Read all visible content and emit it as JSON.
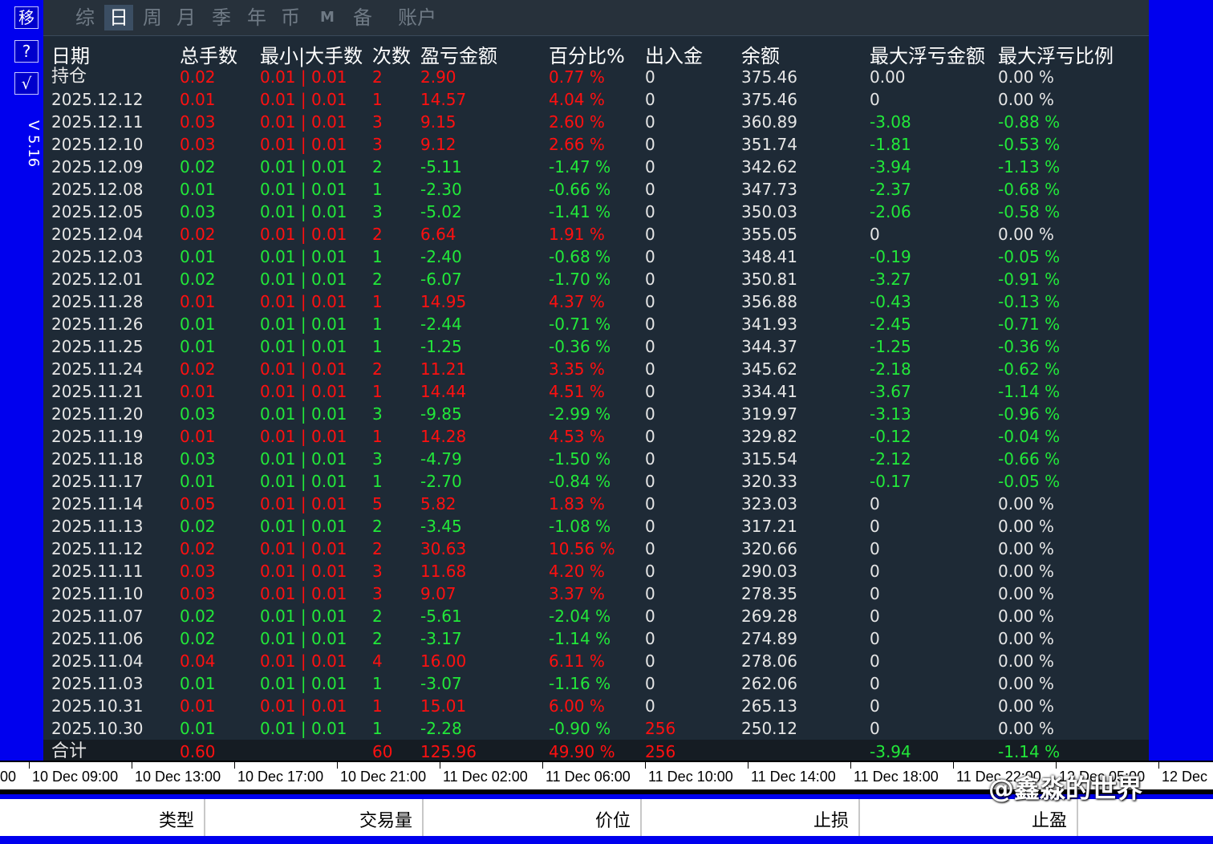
{
  "sidebar": {
    "buttons": [
      "移",
      "?",
      "√"
    ],
    "version": "V 5.16"
  },
  "tabs": [
    "综",
    "日",
    "周",
    "月",
    "季",
    "年",
    "币",
    "M",
    "备",
    "账户"
  ],
  "active_tab": "日",
  "headers": [
    "日期",
    "总手数",
    "最小|大手数",
    "次数",
    "盈亏金额",
    "百分比%",
    "出入金",
    "余额",
    "最大浮亏金额",
    "最大浮亏比例"
  ],
  "rows": [
    {
      "date": "持仓",
      "lots": "0.02",
      "minmax": "0.01 | 0.01",
      "count": "2",
      "pnl": "2.90",
      "pct": "0.77 %",
      "flow": "0",
      "balance": "375.46",
      "maxdd": "0.00",
      "maxddpct": "0.00 %",
      "color": "r",
      "ddcolor": "w"
    },
    {
      "date": "2025.12.12",
      "lots": "0.01",
      "minmax": "0.01 | 0.01",
      "count": "1",
      "pnl": "14.57",
      "pct": "4.04 %",
      "flow": "0",
      "balance": "375.46",
      "maxdd": "0",
      "maxddpct": "0.00 %",
      "color": "r",
      "ddcolor": "w"
    },
    {
      "date": "2025.12.11",
      "lots": "0.03",
      "minmax": "0.01 | 0.01",
      "count": "3",
      "pnl": "9.15",
      "pct": "2.60 %",
      "flow": "0",
      "balance": "360.89",
      "maxdd": "-3.08",
      "maxddpct": "-0.88 %",
      "color": "r",
      "ddcolor": "g"
    },
    {
      "date": "2025.12.10",
      "lots": "0.03",
      "minmax": "0.01 | 0.01",
      "count": "3",
      "pnl": "9.12",
      "pct": "2.66 %",
      "flow": "0",
      "balance": "351.74",
      "maxdd": "-1.81",
      "maxddpct": "-0.53 %",
      "color": "r",
      "ddcolor": "g"
    },
    {
      "date": "2025.12.09",
      "lots": "0.02",
      "minmax": "0.01 | 0.01",
      "count": "2",
      "pnl": "-5.11",
      "pct": "-1.47 %",
      "flow": "0",
      "balance": "342.62",
      "maxdd": "-3.94",
      "maxddpct": "-1.13 %",
      "color": "g",
      "ddcolor": "g"
    },
    {
      "date": "2025.12.08",
      "lots": "0.01",
      "minmax": "0.01 | 0.01",
      "count": "1",
      "pnl": "-2.30",
      "pct": "-0.66 %",
      "flow": "0",
      "balance": "347.73",
      "maxdd": "-2.37",
      "maxddpct": "-0.68 %",
      "color": "g",
      "ddcolor": "g"
    },
    {
      "date": "2025.12.05",
      "lots": "0.03",
      "minmax": "0.01 | 0.01",
      "count": "3",
      "pnl": "-5.02",
      "pct": "-1.41 %",
      "flow": "0",
      "balance": "350.03",
      "maxdd": "-2.06",
      "maxddpct": "-0.58 %",
      "color": "g",
      "ddcolor": "g"
    },
    {
      "date": "2025.12.04",
      "lots": "0.02",
      "minmax": "0.01 | 0.01",
      "count": "2",
      "pnl": "6.64",
      "pct": "1.91 %",
      "flow": "0",
      "balance": "355.05",
      "maxdd": "0",
      "maxddpct": "0.00 %",
      "color": "r",
      "ddcolor": "w"
    },
    {
      "date": "2025.12.03",
      "lots": "0.01",
      "minmax": "0.01 | 0.01",
      "count": "1",
      "pnl": "-2.40",
      "pct": "-0.68 %",
      "flow": "0",
      "balance": "348.41",
      "maxdd": "-0.19",
      "maxddpct": "-0.05 %",
      "color": "g",
      "ddcolor": "g"
    },
    {
      "date": "2025.12.01",
      "lots": "0.02",
      "minmax": "0.01 | 0.01",
      "count": "2",
      "pnl": "-6.07",
      "pct": "-1.70 %",
      "flow": "0",
      "balance": "350.81",
      "maxdd": "-3.27",
      "maxddpct": "-0.91 %",
      "color": "g",
      "ddcolor": "g"
    },
    {
      "date": "2025.11.28",
      "lots": "0.01",
      "minmax": "0.01 | 0.01",
      "count": "1",
      "pnl": "14.95",
      "pct": "4.37 %",
      "flow": "0",
      "balance": "356.88",
      "maxdd": "-0.43",
      "maxddpct": "-0.13 %",
      "color": "r",
      "ddcolor": "g"
    },
    {
      "date": "2025.11.26",
      "lots": "0.01",
      "minmax": "0.01 | 0.01",
      "count": "1",
      "pnl": "-2.44",
      "pct": "-0.71 %",
      "flow": "0",
      "balance": "341.93",
      "maxdd": "-2.45",
      "maxddpct": "-0.71 %",
      "color": "g",
      "ddcolor": "g"
    },
    {
      "date": "2025.11.25",
      "lots": "0.01",
      "minmax": "0.01 | 0.01",
      "count": "1",
      "pnl": "-1.25",
      "pct": "-0.36 %",
      "flow": "0",
      "balance": "344.37",
      "maxdd": "-1.25",
      "maxddpct": "-0.36 %",
      "color": "g",
      "ddcolor": "g"
    },
    {
      "date": "2025.11.24",
      "lots": "0.02",
      "minmax": "0.01 | 0.01",
      "count": "2",
      "pnl": "11.21",
      "pct": "3.35 %",
      "flow": "0",
      "balance": "345.62",
      "maxdd": "-2.18",
      "maxddpct": "-0.62 %",
      "color": "r",
      "ddcolor": "g"
    },
    {
      "date": "2025.11.21",
      "lots": "0.01",
      "minmax": "0.01 | 0.01",
      "count": "1",
      "pnl": "14.44",
      "pct": "4.51 %",
      "flow": "0",
      "balance": "334.41",
      "maxdd": "-3.67",
      "maxddpct": "-1.14 %",
      "color": "r",
      "ddcolor": "g"
    },
    {
      "date": "2025.11.20",
      "lots": "0.03",
      "minmax": "0.01 | 0.01",
      "count": "3",
      "pnl": "-9.85",
      "pct": "-2.99 %",
      "flow": "0",
      "balance": "319.97",
      "maxdd": "-3.13",
      "maxddpct": "-0.96 %",
      "color": "g",
      "ddcolor": "g"
    },
    {
      "date": "2025.11.19",
      "lots": "0.01",
      "minmax": "0.01 | 0.01",
      "count": "1",
      "pnl": "14.28",
      "pct": "4.53 %",
      "flow": "0",
      "balance": "329.82",
      "maxdd": "-0.12",
      "maxddpct": "-0.04 %",
      "color": "r",
      "ddcolor": "g"
    },
    {
      "date": "2025.11.18",
      "lots": "0.03",
      "minmax": "0.01 | 0.01",
      "count": "3",
      "pnl": "-4.79",
      "pct": "-1.50 %",
      "flow": "0",
      "balance": "315.54",
      "maxdd": "-2.12",
      "maxddpct": "-0.66 %",
      "color": "g",
      "ddcolor": "g"
    },
    {
      "date": "2025.11.17",
      "lots": "0.01",
      "minmax": "0.01 | 0.01",
      "count": "1",
      "pnl": "-2.70",
      "pct": "-0.84 %",
      "flow": "0",
      "balance": "320.33",
      "maxdd": "-0.17",
      "maxddpct": "-0.05 %",
      "color": "g",
      "ddcolor": "g"
    },
    {
      "date": "2025.11.14",
      "lots": "0.05",
      "minmax": "0.01 | 0.01",
      "count": "5",
      "pnl": "5.82",
      "pct": "1.83 %",
      "flow": "0",
      "balance": "323.03",
      "maxdd": "0",
      "maxddpct": "0.00 %",
      "color": "r",
      "ddcolor": "w"
    },
    {
      "date": "2025.11.13",
      "lots": "0.02",
      "minmax": "0.01 | 0.01",
      "count": "2",
      "pnl": "-3.45",
      "pct": "-1.08 %",
      "flow": "0",
      "balance": "317.21",
      "maxdd": "0",
      "maxddpct": "0.00 %",
      "color": "g",
      "ddcolor": "w"
    },
    {
      "date": "2025.11.12",
      "lots": "0.02",
      "minmax": "0.01 | 0.01",
      "count": "2",
      "pnl": "30.63",
      "pct": "10.56 %",
      "flow": "0",
      "balance": "320.66",
      "maxdd": "0",
      "maxddpct": "0.00 %",
      "color": "r",
      "ddcolor": "w"
    },
    {
      "date": "2025.11.11",
      "lots": "0.03",
      "minmax": "0.01 | 0.01",
      "count": "3",
      "pnl": "11.68",
      "pct": "4.20 %",
      "flow": "0",
      "balance": "290.03",
      "maxdd": "0",
      "maxddpct": "0.00 %",
      "color": "r",
      "ddcolor": "w"
    },
    {
      "date": "2025.11.10",
      "lots": "0.03",
      "minmax": "0.01 | 0.01",
      "count": "3",
      "pnl": "9.07",
      "pct": "3.37 %",
      "flow": "0",
      "balance": "278.35",
      "maxdd": "0",
      "maxddpct": "0.00 %",
      "color": "r",
      "ddcolor": "w"
    },
    {
      "date": "2025.11.07",
      "lots": "0.02",
      "minmax": "0.01 | 0.01",
      "count": "2",
      "pnl": "-5.61",
      "pct": "-2.04 %",
      "flow": "0",
      "balance": "269.28",
      "maxdd": "0",
      "maxddpct": "0.00 %",
      "color": "g",
      "ddcolor": "w"
    },
    {
      "date": "2025.11.06",
      "lots": "0.02",
      "minmax": "0.01 | 0.01",
      "count": "2",
      "pnl": "-3.17",
      "pct": "-1.14 %",
      "flow": "0",
      "balance": "274.89",
      "maxdd": "0",
      "maxddpct": "0.00 %",
      "color": "g",
      "ddcolor": "w"
    },
    {
      "date": "2025.11.04",
      "lots": "0.04",
      "minmax": "0.01 | 0.01",
      "count": "4",
      "pnl": "16.00",
      "pct": "6.11 %",
      "flow": "0",
      "balance": "278.06",
      "maxdd": "0",
      "maxddpct": "0.00 %",
      "color": "r",
      "ddcolor": "w"
    },
    {
      "date": "2025.11.03",
      "lots": "0.01",
      "minmax": "0.01 | 0.01",
      "count": "1",
      "pnl": "-3.07",
      "pct": "-1.16 %",
      "flow": "0",
      "balance": "262.06",
      "maxdd": "0",
      "maxddpct": "0.00 %",
      "color": "g",
      "ddcolor": "w"
    },
    {
      "date": "2025.10.31",
      "lots": "0.01",
      "minmax": "0.01 | 0.01",
      "count": "1",
      "pnl": "15.01",
      "pct": "6.00 %",
      "flow": "0",
      "balance": "265.13",
      "maxdd": "0",
      "maxddpct": "0.00 %",
      "color": "r",
      "ddcolor": "w"
    },
    {
      "date": "2025.10.30",
      "lots": "0.01",
      "minmax": "0.01 | 0.01",
      "count": "1",
      "pnl": "-2.28",
      "pct": "-0.90 %",
      "flow": "256",
      "balance": "250.12",
      "maxdd": "0",
      "maxddpct": "0.00 %",
      "color": "g",
      "ddcolor": "w",
      "flowcolor": "r"
    }
  ],
  "total": {
    "label": "合计",
    "lots": "0.60",
    "count": "60",
    "pnl": "125.96",
    "pct": "49.90 %",
    "flow": "256",
    "maxdd": "-3.94",
    "maxddpct": "-1.14 %"
  },
  "timeline": [
    "00",
    "10 Dec 09:00",
    "10 Dec 13:00",
    "10 Dec 17:00",
    "10 Dec 21:00",
    "11 Dec 02:00",
    "11 Dec 06:00",
    "11 Dec 10:00",
    "11 Dec 14:00",
    "11 Dec 18:00",
    "11 Dec 22:00",
    "12 Dec 05:00",
    "12 Dec"
  ],
  "trade_headers": [
    "类型",
    "交易量",
    "价位",
    "止损",
    "止盈"
  ],
  "watermark": "@鑫淼的世界",
  "colors": {
    "red": "#ff1010",
    "green": "#22e83a",
    "panel": "#1e2a36",
    "blue": "#0000ee"
  }
}
